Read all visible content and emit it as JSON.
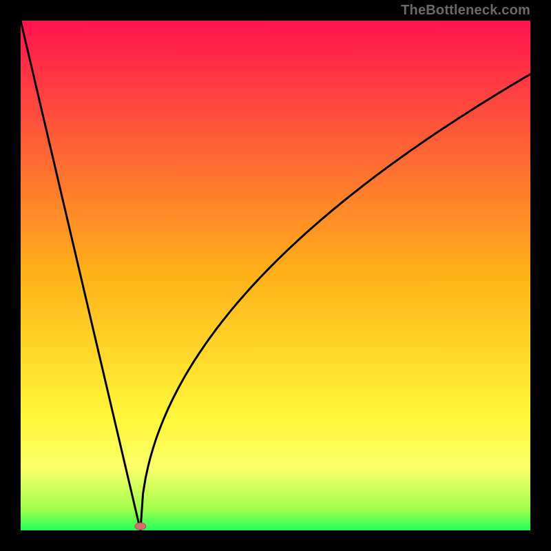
{
  "watermark": "TheBottleneck.com",
  "colors": {
    "frame": "#000000",
    "top": "#ff1350",
    "mid": "#ffd21a",
    "low_yellow": "#fbff6a",
    "green": "#23ff5b",
    "curve": "#000000",
    "marker": "#d66d6d"
  },
  "chart_data": {
    "type": "line",
    "title": "",
    "xlabel": "",
    "ylabel": "",
    "xlim": [
      0,
      100
    ],
    "ylim": [
      0,
      100
    ],
    "note": "Values read visually: x ≈ horizontal % from left edge of plot, y ≈ vertical % where 0 is bottom (green) and 100 is top (red). Left branch is a steep near-linear descent; right branch rises with diminishing slope (square-root-like).",
    "series": [
      {
        "name": "curve",
        "x": [
          0,
          5,
          10,
          15,
          20,
          23.5,
          27,
          30,
          35,
          40,
          45,
          50,
          55,
          60,
          65,
          70,
          75,
          80,
          85,
          90,
          95,
          100
        ],
        "y": [
          100,
          79,
          58,
          37,
          16,
          0,
          16,
          28,
          42,
          52,
          59,
          65,
          70,
          74,
          77,
          80,
          82.5,
          84.5,
          86,
          87.5,
          88.5,
          89.5
        ]
      }
    ],
    "marker": {
      "x": 23.5,
      "y": 0.8,
      "color": "#d66d6d"
    },
    "gradient_stops": [
      {
        "pct": 0,
        "color": "#ff1350"
      },
      {
        "pct": 50,
        "color": "#ffb21a"
      },
      {
        "pct": 78,
        "color": "#fff83a"
      },
      {
        "pct": 88,
        "color": "#fbff6a"
      },
      {
        "pct": 96,
        "color": "#9cff4a"
      },
      {
        "pct": 100,
        "color": "#23ff5b"
      }
    ]
  }
}
